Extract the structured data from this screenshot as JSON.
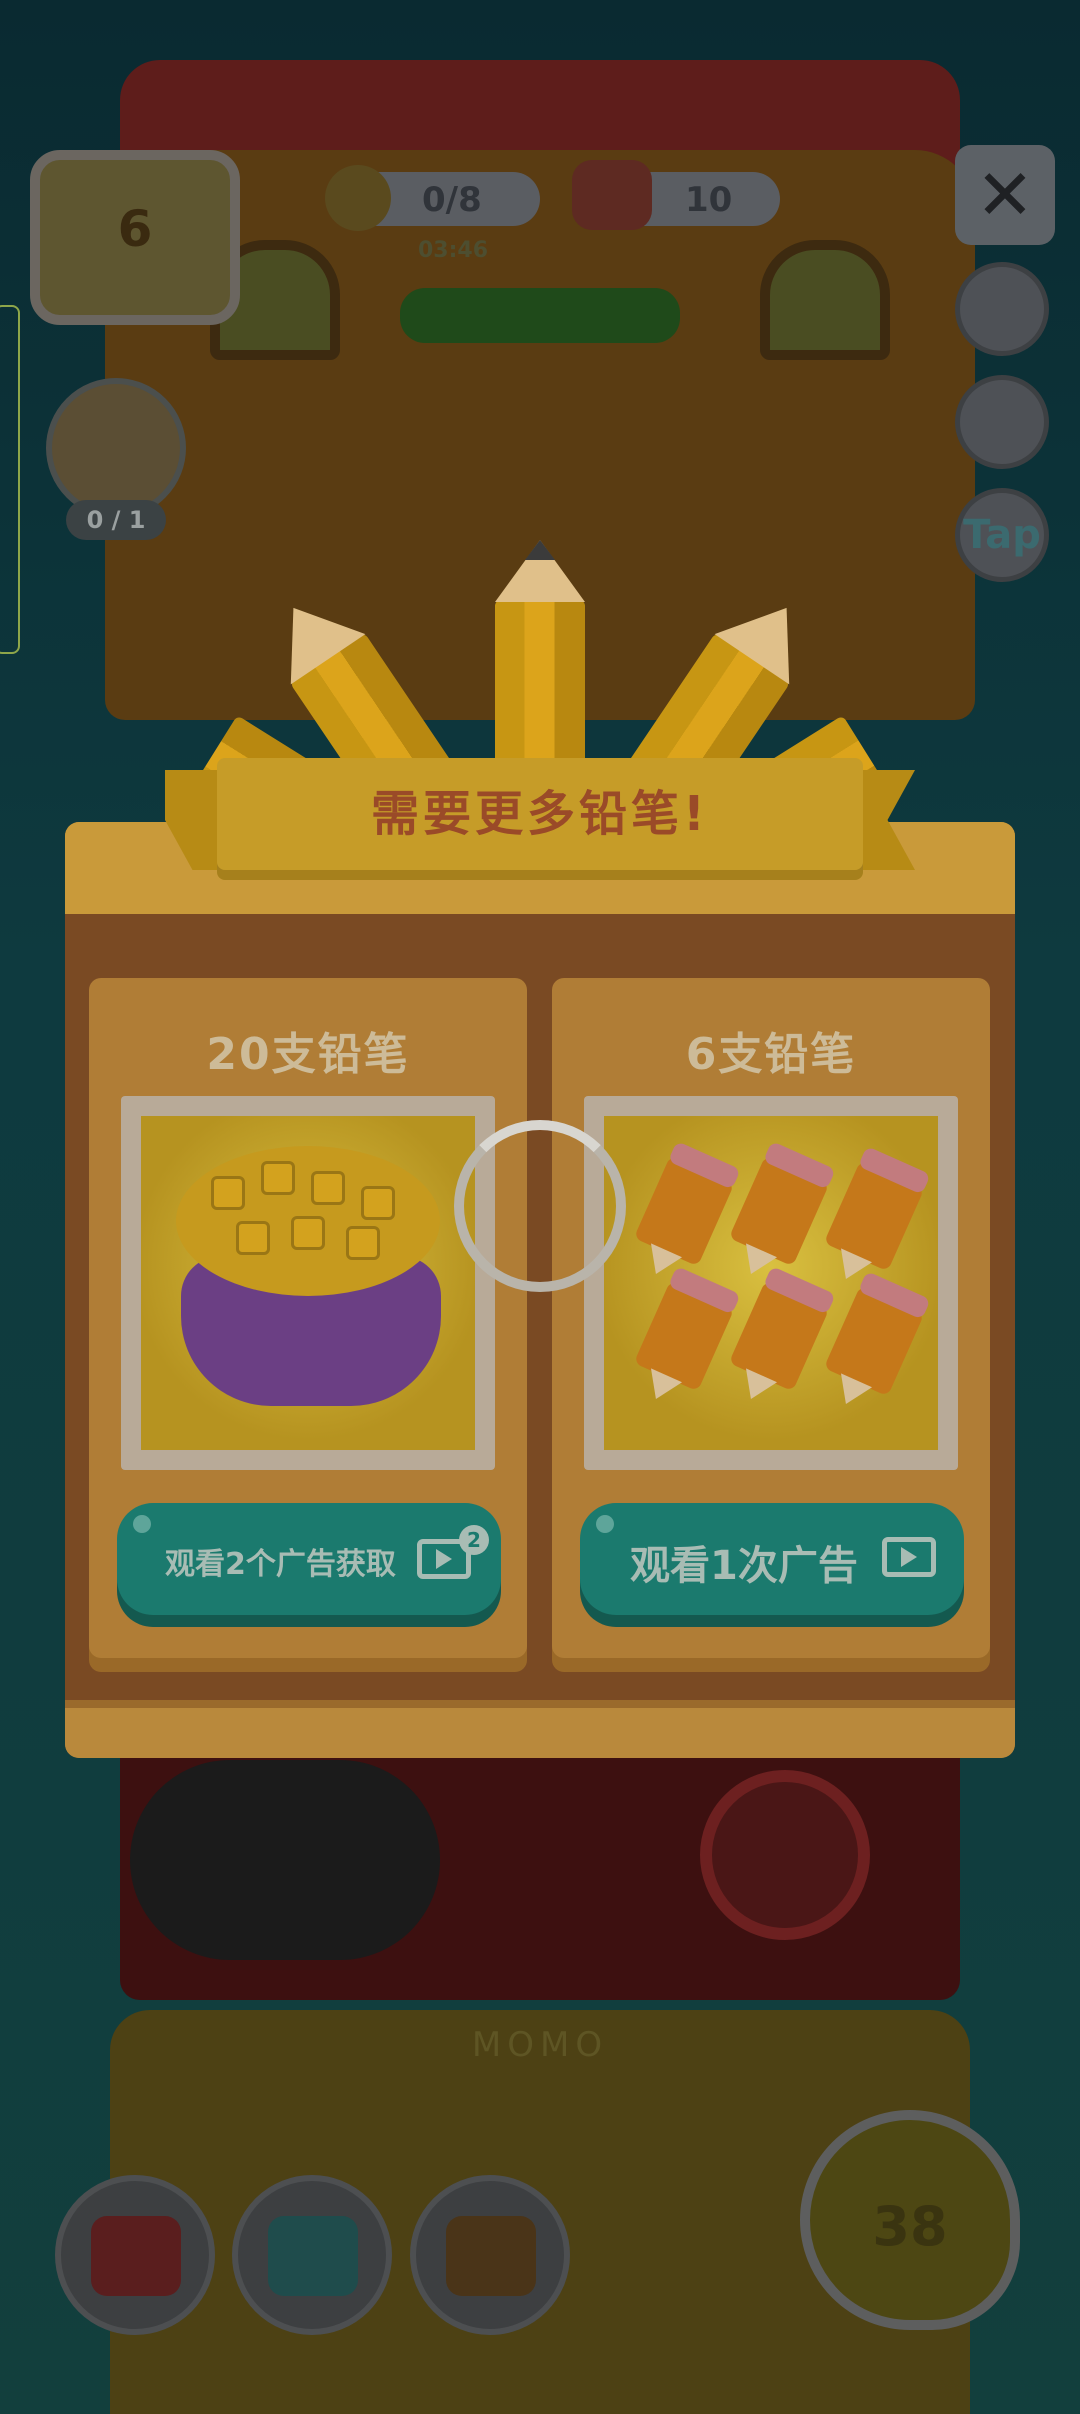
{
  "hud": {
    "level": "6",
    "pencils": "0/8",
    "timer": "03:46",
    "coins": "10",
    "task_progress": "0 / 1",
    "tap_label": "Tap",
    "close_symbol": "✕",
    "score": "38",
    "house_sign": "MOMO"
  },
  "popup": {
    "title": "需要更多铅笔!",
    "options": [
      {
        "title": "20支铅笔",
        "button_label": "观看2个广告获取",
        "ad_count_badge": "2",
        "image": "pencil-sack-icon"
      },
      {
        "title": "6支铅笔",
        "button_label": "观看1次广告",
        "image": "six-pencils-icon"
      }
    ]
  },
  "colors": {
    "ad_button": "#1b7a6e",
    "panel": "#b0762e",
    "banner": "#c69c28",
    "banner_text": "#9a4a28"
  },
  "loading": true
}
